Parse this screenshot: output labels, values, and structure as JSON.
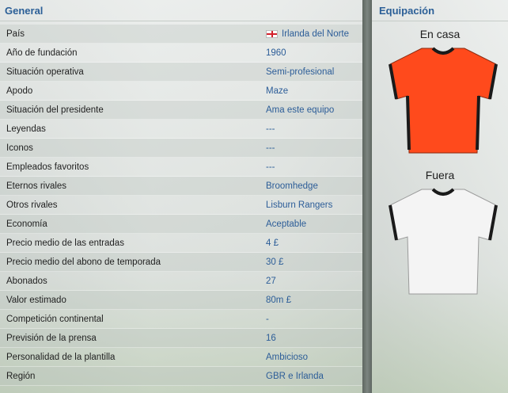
{
  "general": {
    "title": "General",
    "rows": [
      {
        "label": "País",
        "value": "Irlanda del Norte",
        "flag": "northern-ireland-flag"
      },
      {
        "label": "Año de fundación",
        "value": "1960"
      },
      {
        "label": "Situación operativa",
        "value": "Semi-profesional"
      },
      {
        "label": "Apodo",
        "value": "Maze"
      },
      {
        "label": "Situación del presidente",
        "value": "Ama este equipo"
      },
      {
        "label": "Leyendas",
        "value": "---"
      },
      {
        "label": "Iconos",
        "value": "---"
      },
      {
        "label": "Empleados favoritos",
        "value": "---"
      },
      {
        "label": "Eternos rivales",
        "value": "Broomhedge"
      },
      {
        "label": "Otros rivales",
        "value": "Lisburn Rangers"
      },
      {
        "label": "Economía",
        "value": "Aceptable"
      },
      {
        "label": "Precio medio de las entradas",
        "value": "4 £"
      },
      {
        "label": "Precio medio del abono de temporada",
        "value": "30 £"
      },
      {
        "label": "Abonados",
        "value": "27"
      },
      {
        "label": "Valor estimado",
        "value": "80m £"
      },
      {
        "label": "Competición continental",
        "value": "-"
      },
      {
        "label": "Previsión de la prensa",
        "value": "16"
      },
      {
        "label": "Personalidad de la plantilla",
        "value": "Ambicioso"
      },
      {
        "label": "Región",
        "value": "GBR e Irlanda"
      }
    ]
  },
  "equipment": {
    "title": "Equipación",
    "home_label": "En casa",
    "away_label": "Fuera",
    "home_colors": {
      "body": "#ff4a1c",
      "trim": "#1a1a1a"
    },
    "away_colors": {
      "body": "#f4f4f4",
      "trim": "#1a1a1a"
    }
  },
  "accent_color": "#2b5f97"
}
